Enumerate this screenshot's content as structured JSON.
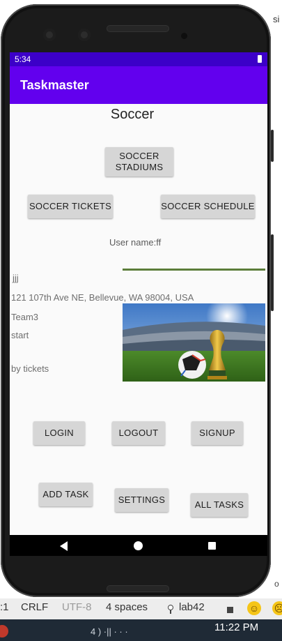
{
  "ide": {
    "right_text": "si",
    "right_tick": "o",
    "status": {
      "line_col": ":1",
      "line_ending": "CRLF",
      "encoding": "UTF-8",
      "indent": "4 spaces",
      "branch": "lab42"
    },
    "taskbar": {
      "app_label": "4 ) ·|| · · ·",
      "clock": "11:22 PM"
    }
  },
  "device": {
    "status_time": "5:34",
    "app_title": "Taskmaster"
  },
  "main": {
    "heading": "Soccer",
    "buttons": {
      "stadiums": "SOCCER STADIUMS",
      "tickets": "SOCCER TICKETS",
      "schedule": "SOCCER SCHEDULE",
      "login": "LOGIN",
      "logout": "LOGOUT",
      "signup": "SIGNUP",
      "add_task": "ADD TASK",
      "settings": "SETTINGS",
      "all_tasks": "ALL TASKS"
    },
    "username": "User name:ff",
    "task": {
      "title": "jjj",
      "address": "121 107th Ave NE, Bellevue, WA 98004, USA",
      "team": "Team3",
      "state": "start",
      "body": "by tickets"
    }
  },
  "colors": {
    "status_bar": "#3c00c8",
    "app_bar": "#6200ee",
    "button_bg": "#d6d6d6"
  }
}
